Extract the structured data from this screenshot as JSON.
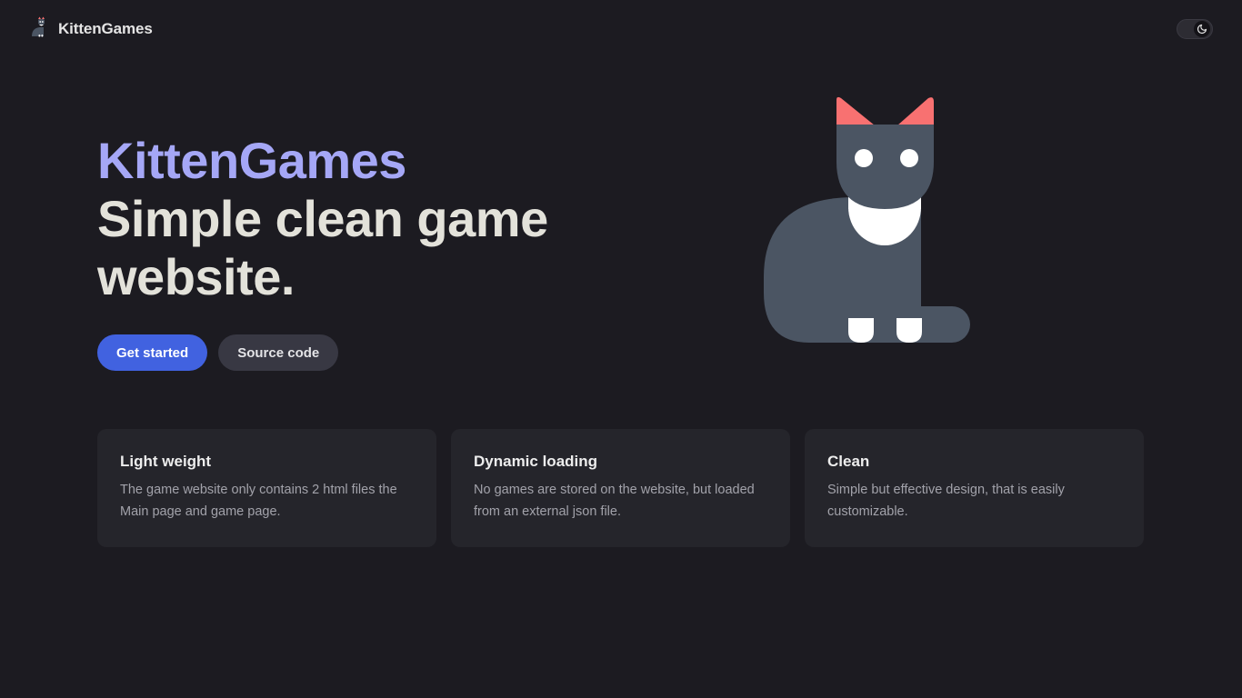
{
  "header": {
    "brand_name": "KittenGames",
    "logo_icon": "cat-logo-icon",
    "theme_toggle_icon": "moon-icon"
  },
  "hero": {
    "title": "KittenGames",
    "subtitle": "Simple clean game website.",
    "primary_button": "Get started",
    "secondary_button": "Source code",
    "illustration": "cat-illustration"
  },
  "features": [
    {
      "title": "Light weight",
      "description": "The game website only contains 2 html files the Main page and game page."
    },
    {
      "title": "Dynamic loading",
      "description": "No games are stored on the website, but loaded from an external json file."
    },
    {
      "title": "Clean",
      "description": "Simple but effective design, that is easily customizable."
    }
  ],
  "colors": {
    "background": "#1c1b21",
    "accent_title": "#a5a7f6",
    "primary_button": "#4162e0",
    "card_background": "#25252b",
    "cat_body": "#4b5563",
    "cat_ears": "#f87171"
  }
}
